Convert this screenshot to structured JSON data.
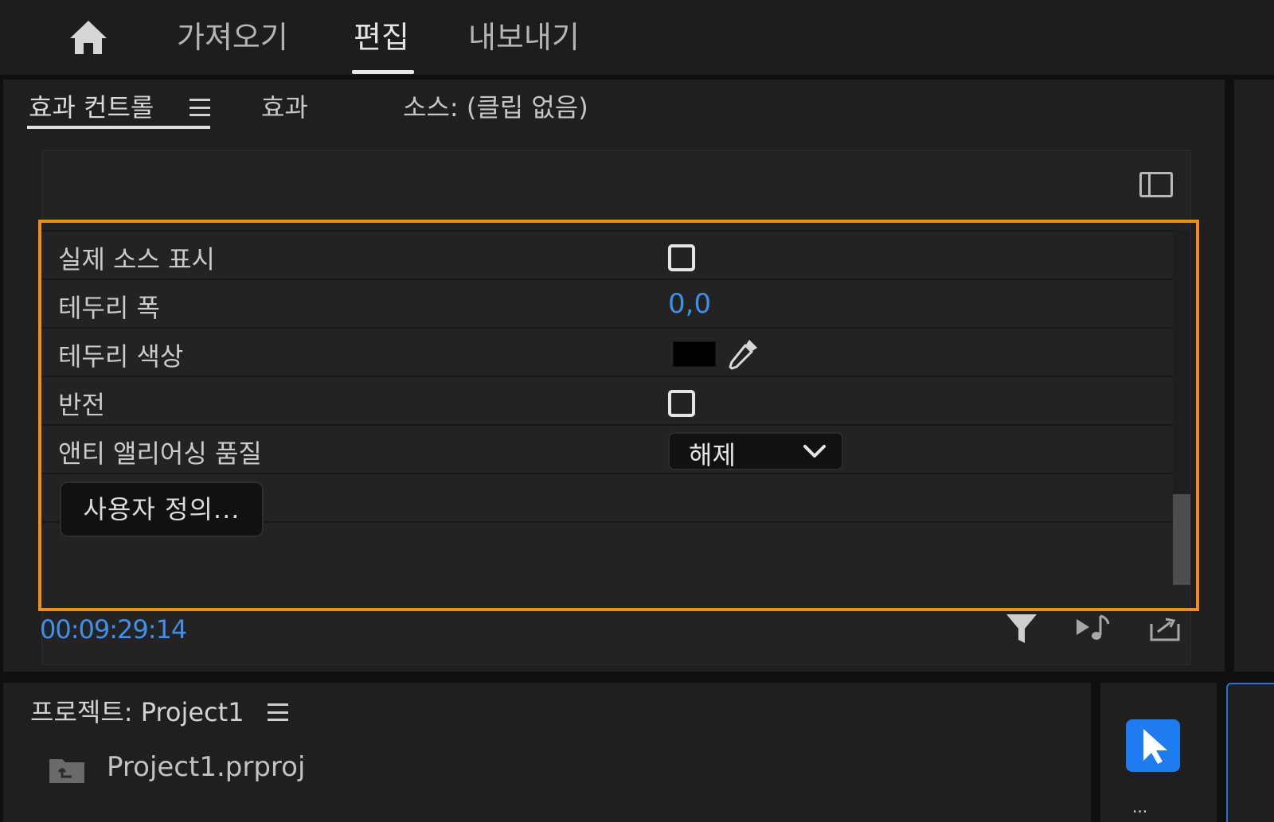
{
  "workspace_tabs": [
    {
      "label": "가져오기",
      "active": false
    },
    {
      "label": "편집",
      "active": true
    },
    {
      "label": "내보내기",
      "active": false
    }
  ],
  "effect_panel": {
    "tabs": [
      {
        "label": "효과 컨트롤",
        "active": true
      },
      {
        "label": "효과",
        "active": false
      },
      {
        "label": "소스: (클립 없음)",
        "active": false
      }
    ],
    "rows": [
      {
        "label": "실제 소스 표시",
        "control": "checkbox",
        "checked": false
      },
      {
        "label": "테두리 폭",
        "control": "value",
        "value": "0,0"
      },
      {
        "label": "테두리 색상",
        "control": "color",
        "color": "#000000"
      },
      {
        "label": "반전",
        "control": "checkbox",
        "checked": false
      },
      {
        "label": "앤티 앨리어싱 품질",
        "control": "dropdown",
        "selected": "해제"
      }
    ],
    "custom_button_label": "사용자 정의...",
    "timecode": "00:09:29:14",
    "highlight_color": "#f08d21",
    "value_color": "#3d8fe8"
  },
  "project_panel": {
    "title": "프로젝트: Project1",
    "file": "Project1.prproj"
  },
  "tools_panel": {
    "dots": "..."
  },
  "icons": [
    "home-icon",
    "panel-menu-icon",
    "panel-toggle-icon",
    "eyedropper-icon",
    "chevron-down-icon",
    "filter-icon",
    "play-audio-icon",
    "export-icon",
    "folder-icon",
    "selection-tool-icon"
  ]
}
